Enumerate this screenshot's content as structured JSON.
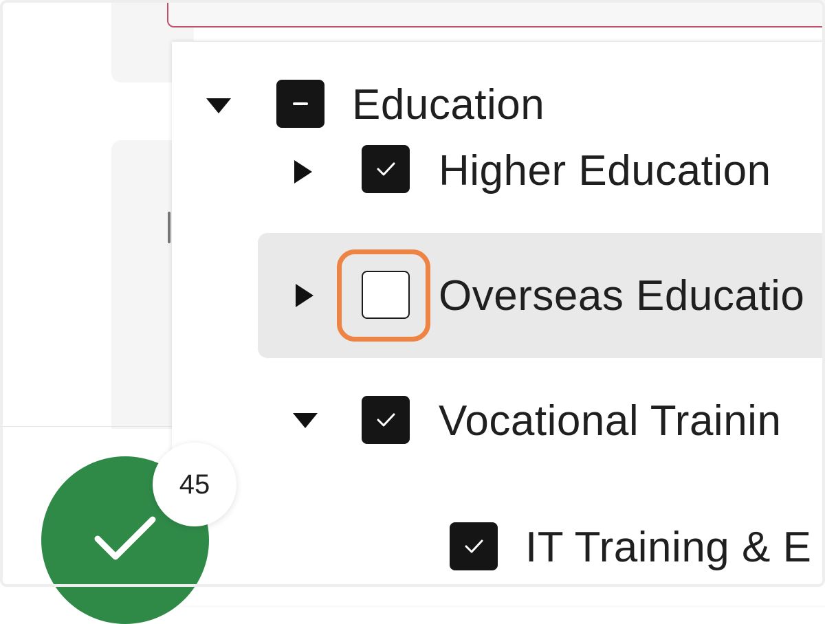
{
  "search": {
    "value": ""
  },
  "tree": {
    "education": {
      "label": "Education",
      "expanded": true,
      "check_state": "indeterminate"
    },
    "higher_education": {
      "label": "Higher Education",
      "expanded": false,
      "check_state": "checked"
    },
    "overseas_education": {
      "label": "Overseas Educatio",
      "expanded": false,
      "check_state": "unchecked",
      "highlighted": true
    },
    "vocational_training": {
      "label": "Vocational Trainin",
      "expanded": true,
      "check_state": "checked"
    },
    "it_training": {
      "label": "IT Training & E",
      "check_state": "checked"
    }
  },
  "selection_badge": {
    "count": "45",
    "icon": "checkmark-icon",
    "color": "#2f8a48"
  },
  "colors": {
    "highlight_ring": "#ed8444",
    "search_border": "#c2506c",
    "hover_row": "#e9e9e9"
  }
}
